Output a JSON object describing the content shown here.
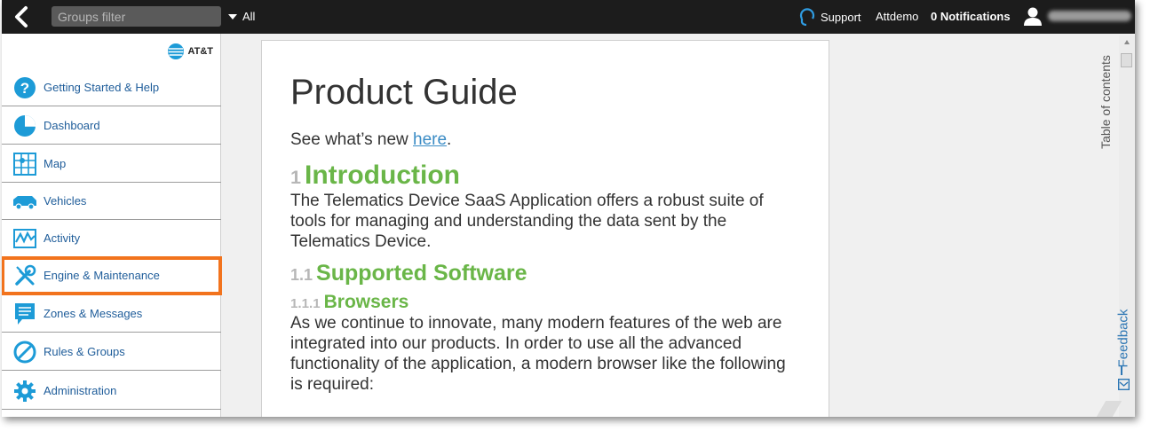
{
  "topbar": {
    "search_placeholder": "Groups filter",
    "group_selector": "All",
    "support": "Support",
    "user": "Attdemo",
    "notifications": "0 Notifications"
  },
  "sidebar": {
    "brand": "AT&T",
    "items": [
      {
        "label": "Getting Started & Help",
        "icon": "help-icon"
      },
      {
        "label": "Dashboard",
        "icon": "dashboard-icon"
      },
      {
        "label": "Map",
        "icon": "map-icon"
      },
      {
        "label": "Vehicles",
        "icon": "vehicle-icon"
      },
      {
        "label": "Activity",
        "icon": "activity-icon"
      },
      {
        "label": "Engine & Maintenance",
        "icon": "wrench-icon",
        "highlighted": true
      },
      {
        "label": "Zones & Messages",
        "icon": "message-icon"
      },
      {
        "label": "Rules & Groups",
        "icon": "rules-icon"
      },
      {
        "label": "Administration",
        "icon": "gear-icon"
      }
    ]
  },
  "document": {
    "title": "Product Guide",
    "whatsnew_prefix": "See what’s new ",
    "whatsnew_link": "here",
    "whatsnew_suffix": ".",
    "h1_num": "1",
    "h1": "Introduction",
    "intro": "The Telematics Device SaaS Application offers a robust suite of tools for managing and understanding the data sent by the Telematics Device.",
    "h2_num": "1.1",
    "h2": "Supported Software",
    "h3_num": "1.1.1",
    "h3": "Browsers",
    "browsers": "As we continue to innovate, many modern features of the web are integrated into our products. In order to use all the advanced functionality of the application, a modern browser like the following is required:"
  },
  "rail": {
    "toc": "Table of contents",
    "feedback": "Feedback"
  },
  "colors": {
    "topbar": "#1c1c1c",
    "accent_green": "#6ab648",
    "link_blue": "#3b8cc5",
    "highlight_orange": "#f2731d"
  }
}
